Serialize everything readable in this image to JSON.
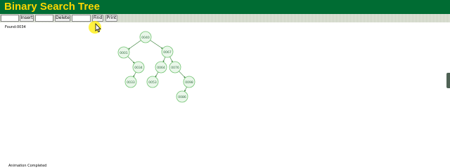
{
  "app": {
    "title": "Binary Search Tree",
    "header_color": "#006c33",
    "title_color": "#ffd700"
  },
  "toolbar": {
    "insert_value": "",
    "insert_label": "Insert",
    "delete_value": "",
    "delete_label": "Delete",
    "find_value": "",
    "find_label": "Find",
    "print_label": "Print"
  },
  "status": {
    "top": "Found:0034",
    "bottom": "Animation Completed"
  },
  "tree": {
    "node_fill": "#eaf7ea",
    "node_stroke": "#6fc26f",
    "edge_color": "#2f7a2f",
    "nodes": [
      {
        "id": "n1",
        "label": "0040"
      },
      {
        "id": "n2",
        "label": "0001"
      },
      {
        "id": "n3",
        "label": "0067"
      },
      {
        "id": "n4",
        "label": "0034"
      },
      {
        "id": "n5",
        "label": "0064"
      },
      {
        "id": "n6",
        "label": "0076"
      },
      {
        "id": "n7",
        "label": "0033"
      },
      {
        "id": "n8",
        "label": "0053"
      },
      {
        "id": "n9",
        "label": "0098"
      },
      {
        "id": "n10",
        "label": "0086"
      }
    ]
  }
}
